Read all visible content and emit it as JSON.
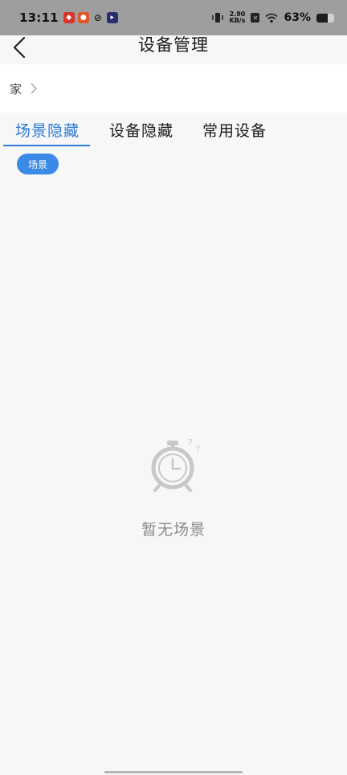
{
  "status_bar": {
    "time": "13:11",
    "net_speed_value": "2.90",
    "net_speed_unit": "KB/s",
    "battery_percent": "63%",
    "battery_level": 0.63
  },
  "header": {
    "title": "设备管理"
  },
  "breadcrumb": {
    "home_label": "家"
  },
  "tabs": [
    {
      "label": "场景隐藏",
      "active": true
    },
    {
      "label": "设备隐藏",
      "active": false
    },
    {
      "label": "常用设备",
      "active": false
    }
  ],
  "filter_chip": {
    "label": "场景"
  },
  "empty_state": {
    "message": "暂无场景"
  },
  "colors": {
    "accent": "#2f7ad6",
    "chip": "#3b8ae5"
  }
}
